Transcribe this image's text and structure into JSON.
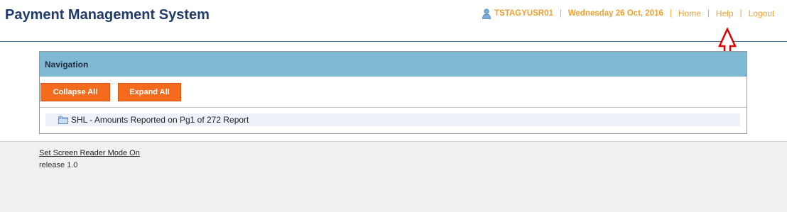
{
  "header": {
    "app_title": "Payment Management System",
    "user_icon": "user-icon",
    "user_id": "TSTAGYUSR01",
    "separator": "|",
    "date": "Wednesday 26 Oct, 2016",
    "links": {
      "home": "Home",
      "help": "Help",
      "logout": "Logout"
    },
    "accent_color": "#f0a030",
    "title_color": "#1f3a6b"
  },
  "navigation": {
    "title": "Navigation",
    "collapse_label": "Collapse All",
    "expand_label": "Expand All",
    "header_color": "#7fb9d3",
    "button_color": "#f56b1e",
    "tree_items": [
      {
        "icon": "folder-icon",
        "label": "SHL - Amounts Reported on Pg1 of 272 Report"
      }
    ]
  },
  "footer": {
    "screen_reader_link": "Set Screen Reader Mode On",
    "release": "release 1.0"
  },
  "annotation": {
    "icon": "up-arrow-icon",
    "color": "#e00000"
  }
}
